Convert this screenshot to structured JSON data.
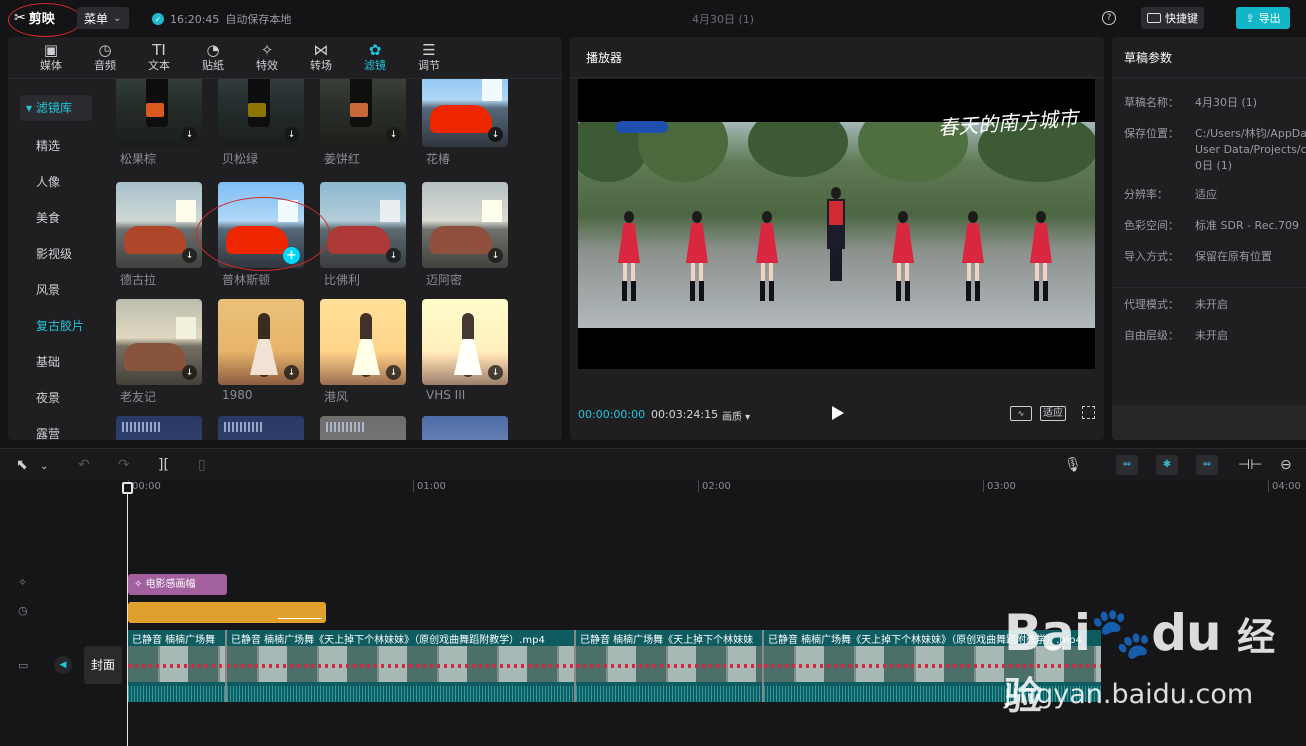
{
  "app": {
    "logo": "剪映",
    "menu": "菜单",
    "save_time": "16:20:45",
    "save_text": "自动保存本地",
    "project_title": "4月30日 (1)",
    "shortcut": "快捷键",
    "export": "导出",
    "help": "?"
  },
  "tabs": [
    {
      "label": "媒体",
      "icon": "media-icon"
    },
    {
      "label": "音频",
      "icon": "audio-icon"
    },
    {
      "label": "文本",
      "icon": "text-icon"
    },
    {
      "label": "贴纸",
      "icon": "sticker-icon"
    },
    {
      "label": "特效",
      "icon": "effects-icon"
    },
    {
      "label": "转场",
      "icon": "transition-icon"
    },
    {
      "label": "滤镜",
      "icon": "filter-icon"
    },
    {
      "label": "调节",
      "icon": "adjust-icon"
    }
  ],
  "filters_sidebar": {
    "header": "滤镜库",
    "items": [
      "精选",
      "人像",
      "美食",
      "影视级",
      "风景",
      "复古胶片",
      "基础",
      "夜景",
      "露营"
    ],
    "active": "复古胶片"
  },
  "filter_grid": [
    {
      "name": "松果棕"
    },
    {
      "name": "贝松绿"
    },
    {
      "name": "姜饼红"
    },
    {
      "name": "花椿"
    },
    {
      "name": "德古拉"
    },
    {
      "name": "普林斯顿"
    },
    {
      "name": "比佛利"
    },
    {
      "name": "迈阿密"
    },
    {
      "name": "老友记"
    },
    {
      "name": "1980"
    },
    {
      "name": "港风"
    },
    {
      "name": "VHS III"
    },
    {
      "name": ""
    },
    {
      "name": ""
    },
    {
      "name": ""
    },
    {
      "name": ""
    }
  ],
  "player": {
    "title": "播放器",
    "calligraphy": "春天的南方城市",
    "time_current": "00:00:00:00",
    "time_total": "00:03:24:15",
    "quality": "画质",
    "fit": "适应"
  },
  "draft": {
    "title": "草稿参数",
    "props": [
      {
        "k": "草稿名称：",
        "v": "4月30日 (1)"
      },
      {
        "k": "保存位置：",
        "v": "C:/Users/林钧/AppDa\nUser Data/Projects/co\n0日 (1)"
      },
      {
        "k": "分辨率：",
        "v": "适应"
      },
      {
        "k": "色彩空间：",
        "v": "标准 SDR - Rec.709"
      },
      {
        "k": "导入方式：",
        "v": "保留在原有位置"
      },
      {
        "k": "代理模式：",
        "v": "未开启"
      },
      {
        "k": "自由层级：",
        "v": "未开启"
      }
    ]
  },
  "timeline": {
    "ruler": [
      "00:00",
      "01:00",
      "02:00",
      "03:00",
      "04:00"
    ],
    "effect_clip": "电影感画幅",
    "cover": "封面",
    "video_segments": [
      {
        "title": "已静音  楠楠广场舞"
      },
      {
        "title": "已静音  楠楠广场舞《天上掉下个林妹妹》（原创戏曲舞蹈附教学）.mp4"
      },
      {
        "title": "已静音  楠楠广场舞《天上掉下个林妹妹"
      },
      {
        "title": "已静音  楠楠广场舞《天上掉下个林妹妹》（原创戏曲舞蹈附教学）.mp4"
      }
    ]
  },
  "watermark": {
    "brand": "Bai",
    "brand2": "du",
    "cn": "经验",
    "url": "jingyan.baidu.com"
  },
  "colors": {
    "accent": "#1fc6de",
    "effect_clip": "#a2619e",
    "filter_clip": "#e0a02e",
    "video_track": "#0e5b60",
    "annotation": "#d32a2a"
  }
}
